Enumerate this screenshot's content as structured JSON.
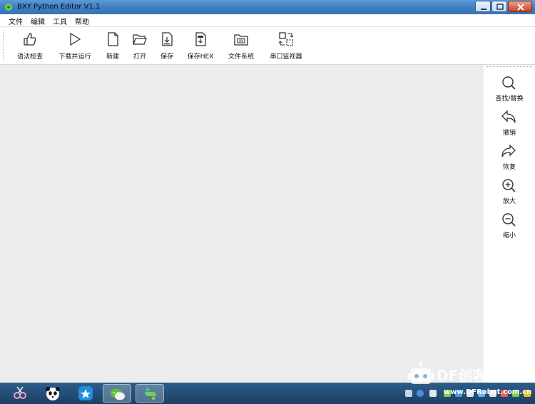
{
  "window": {
    "title": "BXY Python Editor V1.1"
  },
  "menu": {
    "items": [
      "文件",
      "编辑",
      "工具",
      "帮助"
    ]
  },
  "toolbar": {
    "items": [
      {
        "label": "语法检查",
        "icon": "thumbs-up-icon"
      },
      {
        "label": "下载并运行",
        "icon": "play-icon"
      },
      {
        "label": "新建",
        "icon": "new-file-icon"
      },
      {
        "label": "打开",
        "icon": "folder-open-icon"
      },
      {
        "label": "保存",
        "icon": "save-py-icon"
      },
      {
        "label": "保存HEX",
        "icon": "save-hex-icon"
      },
      {
        "label": "文件系统",
        "icon": "file-system-icon"
      },
      {
        "label": "串口监视器",
        "icon": "serial-monitor-icon"
      }
    ]
  },
  "side_panel": {
    "items": [
      {
        "label": "查找/替换",
        "icon": "search-icon"
      },
      {
        "label": "撤销",
        "icon": "undo-icon"
      },
      {
        "label": "恢复",
        "icon": "redo-icon"
      },
      {
        "label": "放大",
        "icon": "zoom-in-icon"
      },
      {
        "label": "缩小",
        "icon": "zoom-out-icon"
      }
    ]
  },
  "watermark": {
    "brand": "DF创客",
    "url": "www.DFRobot.com.cn"
  },
  "colors": {
    "title_bar": "#3f7dc2",
    "editor_bg": "#ececec",
    "taskbar": "#1c3f63"
  }
}
